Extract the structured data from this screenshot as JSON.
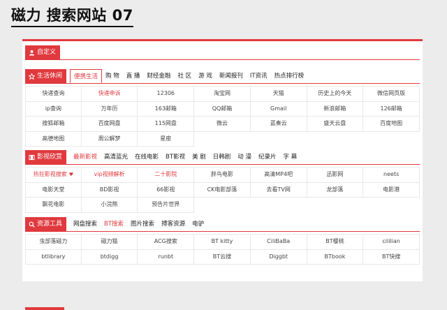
{
  "page_title": "磁力 搜索网站 07",
  "custom": {
    "label": "自定义",
    "icon": "user-icon"
  },
  "sections": [
    {
      "label": "生活休闲",
      "icon": "star-icon",
      "tabs": [
        "便携生活",
        "购 物",
        "直 播",
        "财经金融",
        "社 区",
        "游 戏",
        "新闻报刊",
        "IT资讯",
        "热点排行榜"
      ],
      "active_tab": 0,
      "rows": [
        [
          "快递查询",
          "快递申诉",
          "12306",
          "淘宝网",
          "天猫",
          "历史上的今天",
          "微信网页版"
        ],
        [
          "ip查询",
          "万年历",
          "163邮箱",
          "QQ邮箱",
          "Gmail",
          "新浪邮箱",
          "126邮箱"
        ],
        [
          "搜狐邮箱",
          "百度网盘",
          "115网盘",
          "微云",
          "蓝奏云",
          "盛天云盘",
          "百度地图"
        ],
        [
          "高德地图",
          "周公解梦",
          "星座"
        ]
      ],
      "hot": [
        [
          0,
          1
        ]
      ]
    },
    {
      "label": "影视欣赏",
      "icon": "film-icon",
      "tabs": [
        "最新影视",
        "高清蓝光",
        "在线电影",
        "BT影视",
        "美 剧",
        "日韩剧",
        "动 漫",
        "纪录片",
        "字 幕"
      ],
      "active_tab": -1,
      "red_tab": 0,
      "rows": [
        [
          "热狂影视搜索",
          "vip视频解析",
          "二十影院",
          "胖鸟电影",
          "高清MP4吧",
          "迅影网",
          "neets"
        ],
        [
          "电影天堂",
          "BD影视",
          "66影视",
          "CK电影部落",
          "去看TV网",
          "龙部落",
          "电影港"
        ],
        [
          "飘花电影",
          "小浣熊",
          "预告片世界"
        ]
      ],
      "hot": [
        [
          0,
          0
        ],
        [
          0,
          1
        ],
        [
          0,
          2
        ]
      ]
    },
    {
      "label": "资源工具",
      "icon": "search-icon",
      "tabs": [
        "网盘搜索",
        "BT搜索",
        "图片搜索",
        "搏客资源",
        "电驴"
      ],
      "active_tab": -1,
      "red_tab": 1,
      "rows": [
        [
          "虫部落磁力",
          "磁力猫",
          "ACG搜索",
          "BT kitty",
          "CiliBaBa",
          "BT樱桃",
          "cililian"
        ],
        [
          "btlibrary",
          "btdigg",
          "runbt",
          "BT云搜",
          "Diggbt",
          "BTbook",
          "BT快搜"
        ]
      ],
      "hot": []
    }
  ],
  "colors": {
    "accent": "#e0393e",
    "background": "#ececec"
  }
}
